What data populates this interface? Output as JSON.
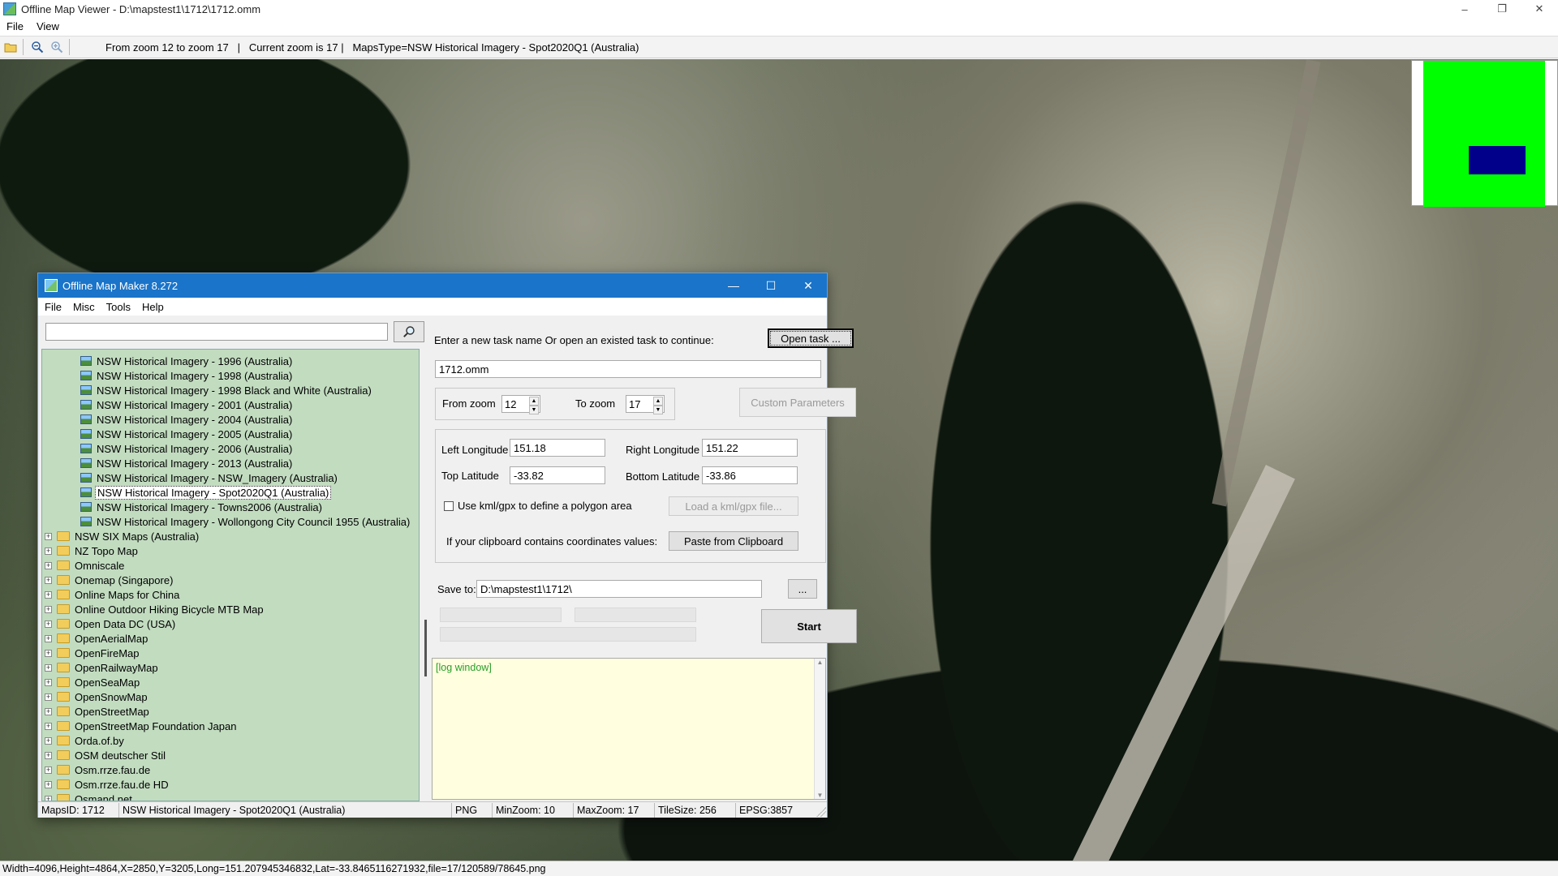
{
  "viewer": {
    "title": "Offline Map Viewer - D:\\mapstest1\\1712\\1712.omm",
    "window_controls": {
      "minimize": "–",
      "restore": "❐",
      "close": "✕"
    },
    "menu": [
      "File",
      "View"
    ],
    "toolbar_info": {
      "zoom_range": "From zoom 12 to zoom 17",
      "sep1": "|",
      "current_zoom": "Current zoom is 17 |",
      "maps_type": "MapsType=NSW Historical Imagery - Spot2020Q1 (Australia)"
    },
    "status": "Width=4096,Height=4864,X=2850,Y=3205,Long=151.207945346832,Lat=-33.8465116271932,file=17/120589/78645.png",
    "overview_colors": {
      "background": "#00ff00",
      "viewport": "#00008b"
    }
  },
  "dialog": {
    "title": "Offline Map Maker 8.272",
    "window_controls": {
      "minimize": "—",
      "maximize": "☐",
      "close": "✕"
    },
    "menu": [
      "File",
      "Misc",
      "Tools",
      "Help"
    ],
    "search": {
      "value": ""
    },
    "tree": {
      "leaves": [
        "NSW Historical Imagery - 1996 (Australia)",
        "NSW Historical Imagery - 1998 (Australia)",
        "NSW Historical Imagery - 1998 Black and White (Australia)",
        "NSW Historical Imagery - 2001 (Australia)",
        "NSW Historical Imagery - 2004 (Australia)",
        "NSW Historical Imagery - 2005 (Australia)",
        "NSW Historical Imagery - 2006 (Australia)",
        "NSW Historical Imagery - 2013 (Australia)",
        "NSW Historical Imagery - NSW_Imagery (Australia)",
        "NSW Historical Imagery - Spot2020Q1 (Australia)",
        "NSW Historical Imagery - Towns2006 (Australia)",
        "NSW Historical Imagery - Wollongong City Council 1955 (Australia)"
      ],
      "selected_index": 9,
      "folders": [
        "NSW SIX Maps (Australia)",
        "NZ Topo Map",
        "Omniscale",
        "Onemap (Singapore)",
        "Online Maps for China",
        "Online Outdoor Hiking Bicycle MTB Map",
        "Open Data DC (USA)",
        "OpenAerialMap",
        "OpenFireMap",
        "OpenRailwayMap",
        "OpenSeaMap",
        "OpenSnowMap",
        "OpenStreetMap",
        "OpenStreetMap Foundation Japan",
        "Orda.of.by",
        "OSM deutscher Stil",
        "Osm.rrze.fau.de",
        "Osm.rrze.fau.de HD",
        "Osmand.net"
      ],
      "expander": "+"
    },
    "task": {
      "prompt": "Enter a new task name Or open an existed task to continue:",
      "open_task_button": "Open task ...",
      "task_name": "1712.omm"
    },
    "zoom": {
      "from_label": "From zoom",
      "from_value": "12",
      "to_label": "To zoom",
      "to_value": "17",
      "custom_params_button": "Custom Parameters"
    },
    "coords": {
      "left_longitude_label": "Left Longitude",
      "left_longitude": "151.18",
      "right_longitude_label": "Right Longitude",
      "right_longitude": "151.22",
      "top_latitude_label": "Top Latitude",
      "top_latitude": "-33.82",
      "bottom_latitude_label": "Bottom Latitude",
      "bottom_latitude": "-33.86",
      "kml_checkbox_label": "Use kml/gpx to define a polygon area",
      "kml_checked": false,
      "load_kml_button": "Load a kml/gpx file...",
      "clipboard_label": "If your clipboard contains coordinates values:",
      "paste_button": "Paste from Clipboard"
    },
    "save": {
      "label": "Save to:",
      "path": "D:\\mapstest1\\1712\\",
      "browse_button": "...",
      "start_button": "Start"
    },
    "log": {
      "text": "[log window]"
    },
    "status": {
      "maps_id": "MapsID: 1712",
      "maps_name": "NSW Historical Imagery - Spot2020Q1 (Australia)",
      "format": "PNG",
      "min_zoom": "MinZoom: 10",
      "max_zoom": "MaxZoom: 17",
      "tile_size": "TileSize: 256",
      "epsg": "EPSG:3857"
    }
  }
}
